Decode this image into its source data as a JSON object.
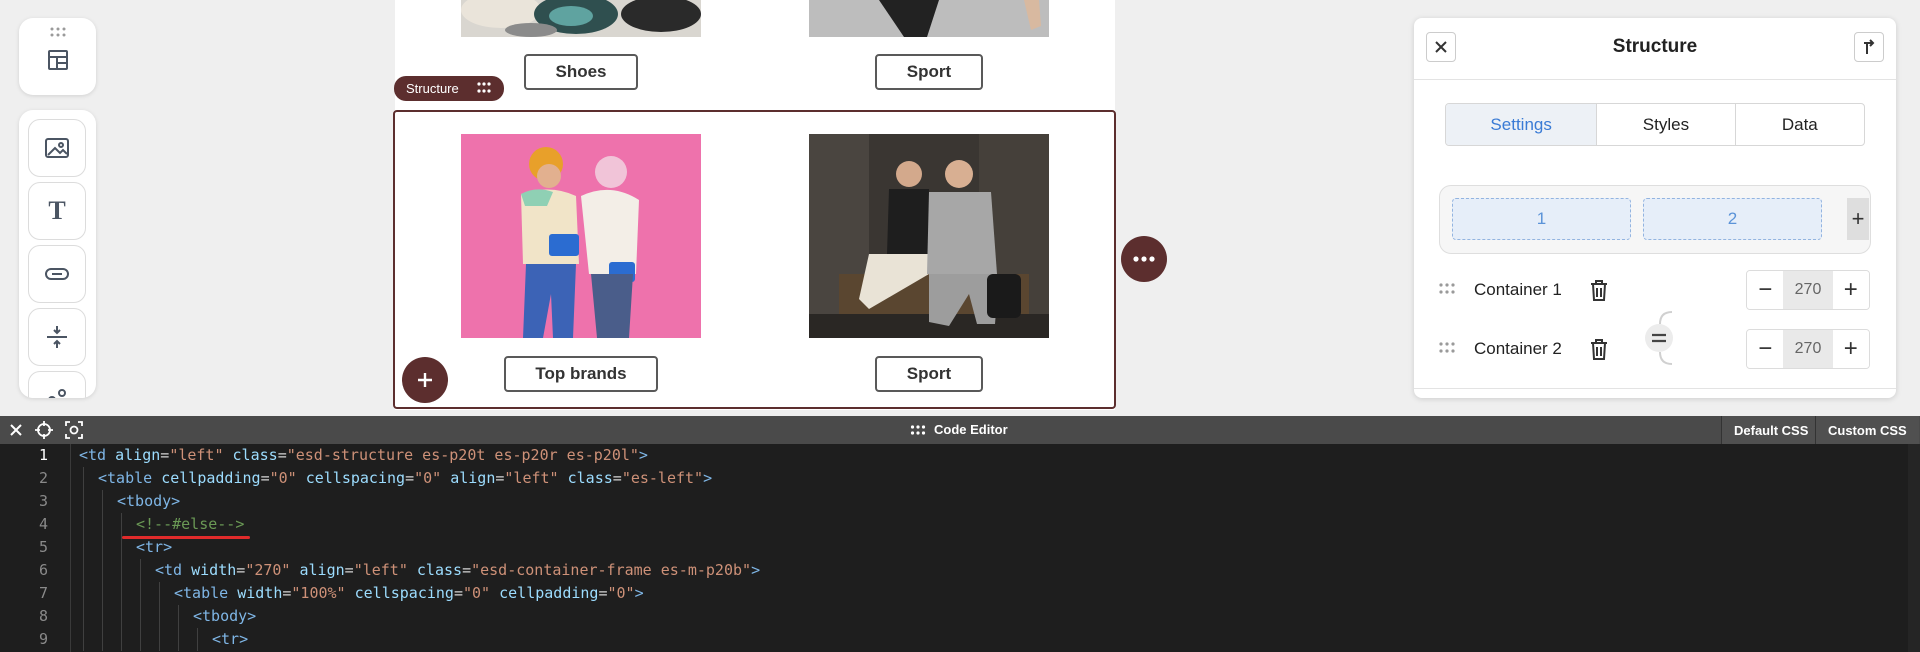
{
  "canvas": {
    "row1": {
      "left_button": "Shoes",
      "right_button": "Sport"
    },
    "row2": {
      "left_button": "Top brands",
      "right_button": "Sport"
    },
    "structure_label": "Structure"
  },
  "panel": {
    "title": "Structure",
    "tabs": [
      {
        "label": "Settings",
        "active": true
      },
      {
        "label": "Styles",
        "active": false
      },
      {
        "label": "Data",
        "active": false
      }
    ],
    "columns": [
      "1",
      "2"
    ],
    "add_column": "+",
    "containers": [
      {
        "name": "Container 1",
        "width": "270"
      },
      {
        "name": "Container 2",
        "width": "270"
      }
    ],
    "minus": "−",
    "plus": "+"
  },
  "editor": {
    "title": "Code Editor",
    "buttons": [
      "Default CSS",
      "Custom CSS"
    ],
    "lines": [
      {
        "n": "1",
        "indent": 0,
        "html": "<span class=\"t\">&lt;td</span> <span class=\"a\">align</span><span class=\"p\">=</span><span class=\"s\">\"left\"</span> <span class=\"a\">class</span><span class=\"p\">=</span><span class=\"s\">\"esd-structure es-p20t es-p20r es-p20l\"</span><span class=\"t\">&gt;</span>"
      },
      {
        "n": "2",
        "indent": 1,
        "html": "<span class=\"t\">&lt;table</span> <span class=\"a\">cellpadding</span><span class=\"p\">=</span><span class=\"s\">\"0\"</span> <span class=\"a\">cellspacing</span><span class=\"p\">=</span><span class=\"s\">\"0\"</span> <span class=\"a\">align</span><span class=\"p\">=</span><span class=\"s\">\"left\"</span> <span class=\"a\">class</span><span class=\"p\">=</span><span class=\"s\">\"es-left\"</span><span class=\"t\">&gt;</span>"
      },
      {
        "n": "3",
        "indent": 2,
        "html": "<span class=\"t\">&lt;tbody&gt;</span>"
      },
      {
        "n": "4",
        "indent": 3,
        "html": "<span class=\"c\">&lt;!--#else--&gt;</span>"
      },
      {
        "n": "5",
        "indent": 3,
        "html": "<span class=\"t\">&lt;tr&gt;</span>"
      },
      {
        "n": "6",
        "indent": 4,
        "html": "<span class=\"t\">&lt;td</span> <span class=\"a\">width</span><span class=\"p\">=</span><span class=\"s\">\"270\"</span> <span class=\"a\">align</span><span class=\"p\">=</span><span class=\"s\">\"left\"</span> <span class=\"a\">class</span><span class=\"p\">=</span><span class=\"s\">\"esd-container-frame es-m-p20b\"</span><span class=\"t\">&gt;</span>"
      },
      {
        "n": "7",
        "indent": 5,
        "html": "<span class=\"t\">&lt;table</span> <span class=\"a\">width</span><span class=\"p\">=</span><span class=\"s\">\"100%\"</span> <span class=\"a\">cellspacing</span><span class=\"p\">=</span><span class=\"s\">\"0\"</span> <span class=\"a\">cellpadding</span><span class=\"p\">=</span><span class=\"s\">\"0\"</span><span class=\"t\">&gt;</span>"
      },
      {
        "n": "8",
        "indent": 6,
        "html": "<span class=\"t\">&lt;tbody&gt;</span>"
      },
      {
        "n": "9",
        "indent": 7,
        "html": "<span class=\"t\">&lt;tr&gt;</span>"
      }
    ]
  }
}
